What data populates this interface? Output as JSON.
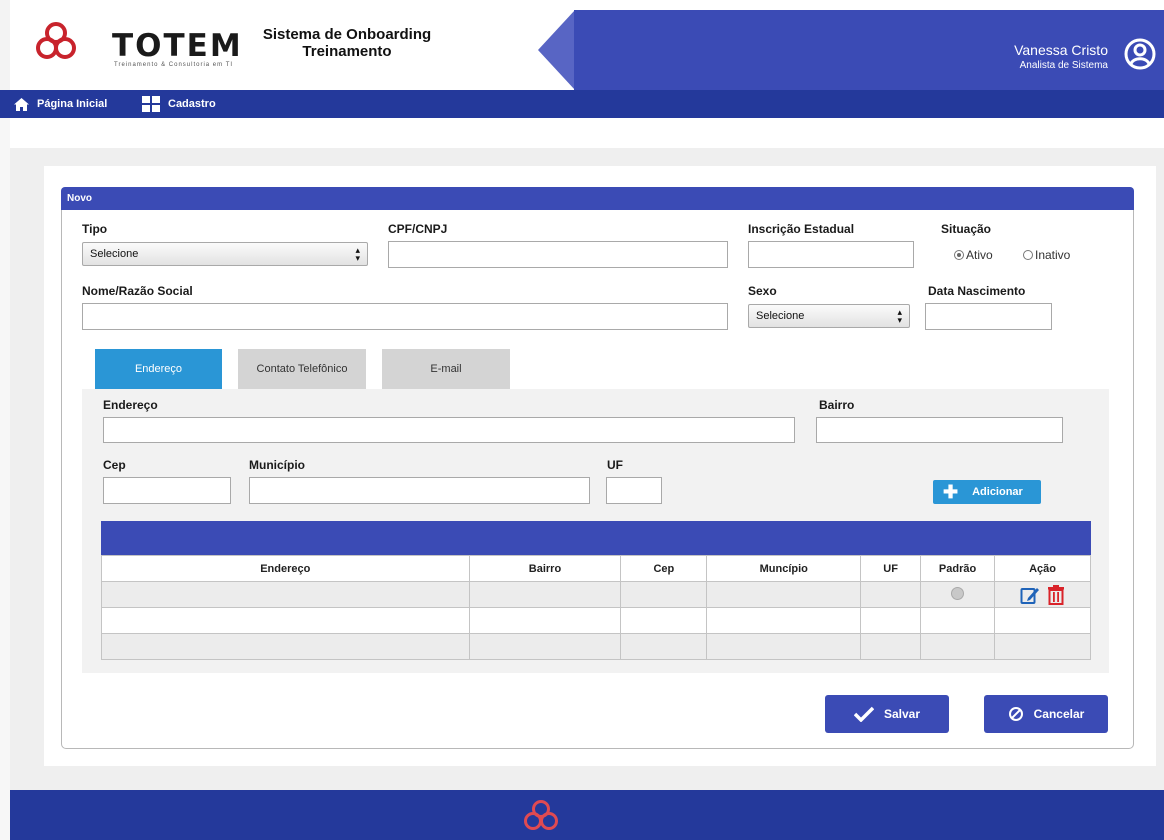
{
  "header": {
    "logo_text": "TOTEM",
    "logo_subtitle": "Treinamento & Consultoria em TI",
    "app_title_line1": "Sistema de Onboarding",
    "app_title_line2": "Treinamento",
    "user_name": "Vanessa Cristo",
    "user_role": "Analista de Sistema"
  },
  "nav": {
    "items": [
      {
        "label": "Página Inicial",
        "icon": "home-icon"
      },
      {
        "label": "Cadastro",
        "icon": "grid-icon"
      }
    ]
  },
  "panel": {
    "title": "Novo"
  },
  "form": {
    "tipo_label": "Tipo",
    "tipo_value": "Selecione",
    "cpf_label": "CPF/CNPJ",
    "cpf_value": "",
    "ie_label": "Inscrição Estadual",
    "ie_value": "",
    "situacao_label": "Situação",
    "situacao_options": [
      "Ativo",
      "Inativo"
    ],
    "situacao_selected": "Ativo",
    "nome_label": "Nome/Razão Social",
    "nome_value": "",
    "sexo_label": "Sexo",
    "sexo_value": "Selecione",
    "nasc_label": "Data Nascimento",
    "nasc_value": ""
  },
  "tabs": [
    {
      "label": "Endereço",
      "active": true
    },
    {
      "label": "Contato Telefônico",
      "active": false
    },
    {
      "label": "E-mail",
      "active": false
    }
  ],
  "address": {
    "endereco_label": "Endereço",
    "bairro_label": "Bairro",
    "cep_label": "Cep",
    "municipio_label": "Município",
    "uf_label": "UF",
    "add_button": "Adicionar"
  },
  "table": {
    "headers": [
      "Endereço",
      "Bairro",
      "Cep",
      "Muncípio",
      "UF",
      "Padrão",
      "Ação"
    ],
    "rows": 3
  },
  "actions": {
    "save": "Salvar",
    "cancel": "Cancelar"
  },
  "colors": {
    "primary": "#3b4bb5",
    "nav": "#24399b",
    "accent": "#2a96d6",
    "danger": "#d9232a"
  }
}
